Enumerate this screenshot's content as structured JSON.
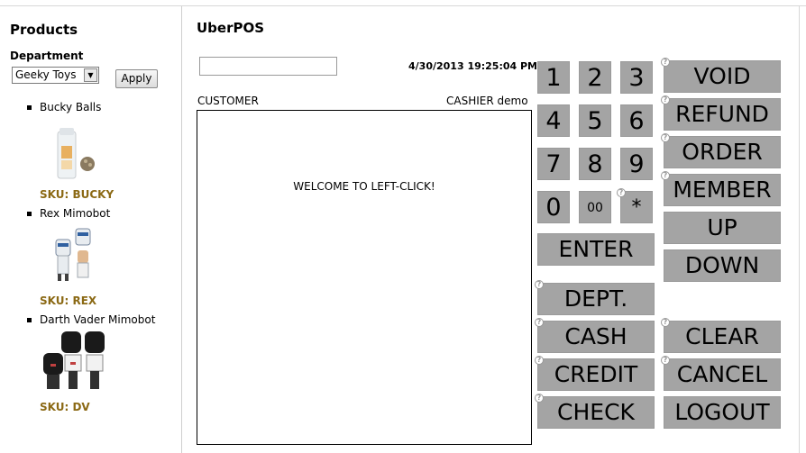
{
  "sidebar": {
    "title": "Products",
    "department_label": "Department",
    "department_value": "Geeky Toys",
    "apply_label": "Apply",
    "products": [
      {
        "name": "Bucky Balls",
        "sku": "SKU: BUCKY"
      },
      {
        "name": "Rex Mimobot",
        "sku": "SKU: REX"
      },
      {
        "name": "Darth Vader Mimobot",
        "sku": "SKU: DV"
      }
    ]
  },
  "header": {
    "title": "UberPOS",
    "datetime": "4/30/2013 19:25:04 PM",
    "search_value": ""
  },
  "display": {
    "customer_label": "CUSTOMER",
    "cashier_label": "CASHIER demo",
    "message": "WELCOME TO LEFT-CLICK!"
  },
  "keypad": {
    "k1": "1",
    "k2": "2",
    "k3": "3",
    "k4": "4",
    "k5": "5",
    "k6": "6",
    "k7": "7",
    "k8": "8",
    "k9": "9",
    "k0": "0",
    "k00": "00",
    "kstar": "*",
    "enter": "ENTER"
  },
  "functions": {
    "void": "VOID",
    "refund": "REFUND",
    "order": "ORDER",
    "member": "MEMBER",
    "up": "UP",
    "down": "DOWN",
    "dept": "DEPT.",
    "cash": "CASH",
    "credit": "CREDIT",
    "check": "CHECK",
    "clear": "CLEAR",
    "cancel": "CANCEL",
    "logout": "LOGOUT"
  },
  "help_icon": "?",
  "colors": {
    "key_bg": "#a4a4a4",
    "sku_color": "#8b6914"
  }
}
